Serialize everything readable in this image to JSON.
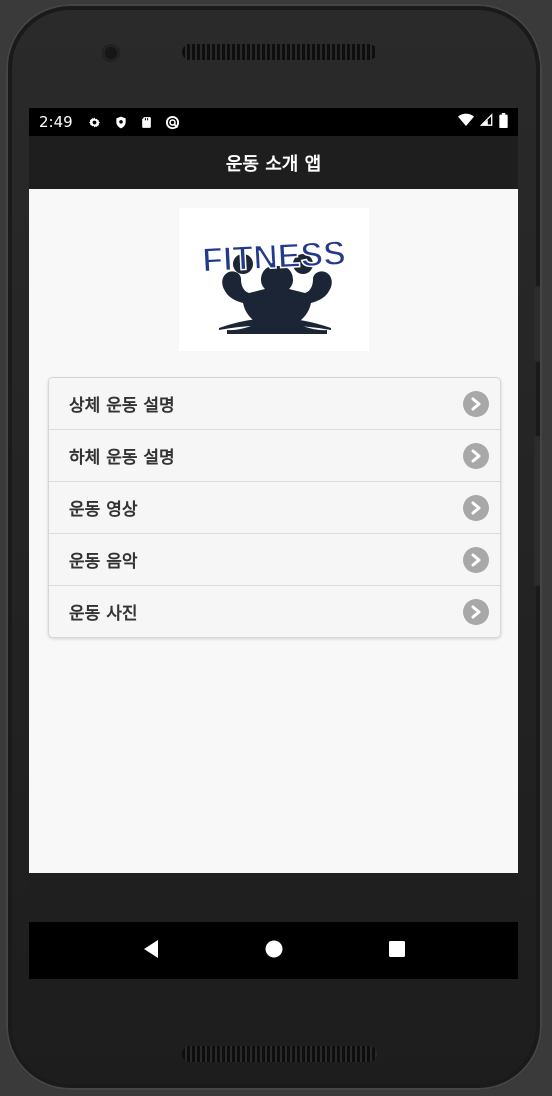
{
  "status_bar": {
    "time": "2:49",
    "left_icons": [
      "gear-icon",
      "shield-icon",
      "sd-card-icon",
      "sync-icon"
    ],
    "right_icons": [
      "wifi-icon",
      "signal-icon",
      "battery-icon"
    ]
  },
  "app_bar": {
    "title": "운동 소개 앱"
  },
  "logo": {
    "text": "FITNESS"
  },
  "menu": {
    "items": [
      {
        "label": "상체 운동 설명"
      },
      {
        "label": "하체 운동 설명"
      },
      {
        "label": "운동 영상"
      },
      {
        "label": "운동 음악"
      },
      {
        "label": "운동 사진"
      }
    ]
  },
  "nav_bar": {
    "buttons": [
      "back-icon",
      "home-icon",
      "recents-icon"
    ]
  },
  "colors": {
    "app_bar": "#1e1e1e",
    "logo_blue": "#233a8a",
    "figure": "#1c2535",
    "chevron_bg": "#a8a8a8"
  }
}
